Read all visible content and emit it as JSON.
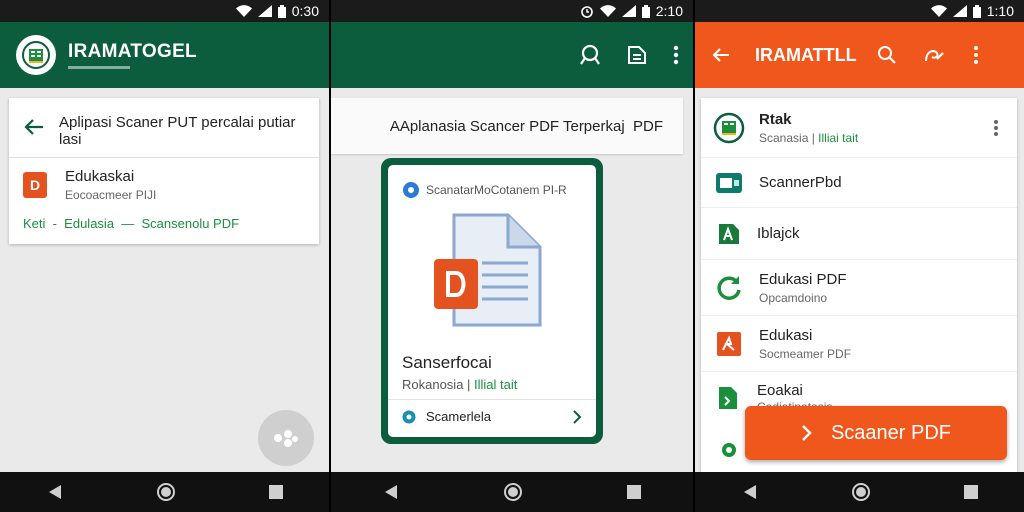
{
  "screen1": {
    "time": "0:30",
    "app_title": "IRAMATOGEL",
    "card_title": "Aplipasi Scaner PUT percalai putiar lasi",
    "item": {
      "title": "Edukaskai",
      "subtitle": "Eocoacmeer PIJI"
    },
    "tags": "Keti  -  Edulasia  —  Scansenolu PDF"
  },
  "screen2": {
    "time": "2:10",
    "search_label": "AAplanasia Scancer PDF Terperkaj  PDF",
    "inner_header": "ScanatarMoCotanem PI-R",
    "doc_title": "Sanserfocai",
    "doc_subtitle_a": "Rokanosia | ",
    "doc_subtitle_b": "Illial tait",
    "action_label": "Scamerlela"
  },
  "screen3": {
    "time": "1:10",
    "app_title": "IRAMATTLL",
    "items": [
      {
        "title": "Rtak",
        "subtitle_a": "Scanasia | ",
        "subtitle_b": "Illiai tait"
      },
      {
        "title": "ScannerPbd"
      },
      {
        "title": "Iblajck"
      },
      {
        "title": "Edukasi PDF",
        "subtitle": "Opcamdoino"
      },
      {
        "title": "Edukasi",
        "subtitle": "Socmeamer PDF"
      },
      {
        "title": "Eoakai",
        "subtitle": "Cadiatinatasis"
      }
    ],
    "fab_label": "Scaaner PDF"
  },
  "colors": {
    "green": "#0b5d3e",
    "orange": "#f0571c",
    "accent_green": "#1a8f3c"
  }
}
